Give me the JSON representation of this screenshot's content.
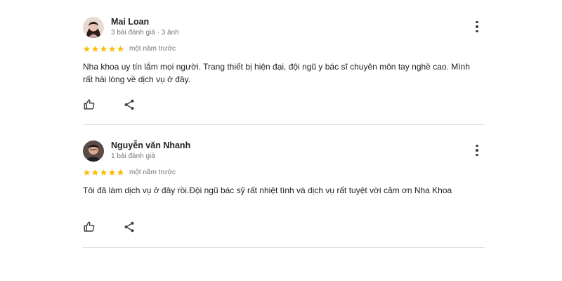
{
  "colors": {
    "star": "#fbbc04",
    "divider": "#dadce0",
    "text": "#202124",
    "meta": "#70757a"
  },
  "reviews": [
    {
      "author": "Mai Loan",
      "meta": "3 bài đánh giá · 3 ảnh",
      "rating": 5,
      "time": "một năm trước",
      "text": "Nha khoa uy tín lắm mọi người. Trang thiết bị hiện đại, đội ngũ y bác sĩ chuyên môn tay nghề cao. Mình rất hài lòng về dịch vụ ở đây.",
      "icons": {
        "like": "thumbs-up-icon",
        "share": "share-icon",
        "menu": "more-vert-icon"
      }
    },
    {
      "author": "Nguyễn văn Nhanh",
      "meta": "1 bài đánh giá",
      "rating": 5,
      "time": "một năm trước",
      "text": "Tôi đã làm dịch vụ ở đây rồi.Đội ngũ bác sỹ rất nhiệt tình và dịch vụ rất tuyệt vời cảm ơn Nha Khoa",
      "icons": {
        "like": "thumbs-up-icon",
        "share": "share-icon",
        "menu": "more-vert-icon"
      }
    }
  ]
}
